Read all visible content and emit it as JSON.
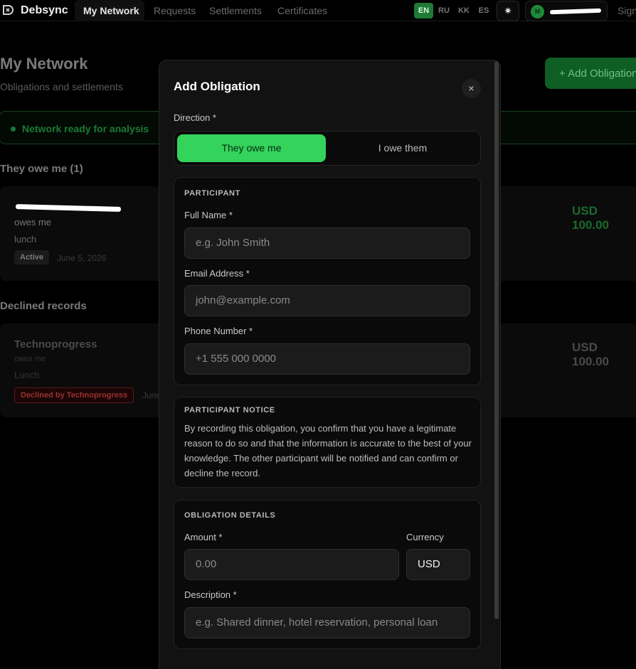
{
  "nav": {
    "brand": "Debsync",
    "links": [
      "My Network",
      "Requests",
      "Settlements",
      "Certificates"
    ],
    "languages": [
      "EN",
      "RU",
      "KK",
      "ES"
    ],
    "active_language": "EN",
    "theme_icon": "sun-icon",
    "avatar_initial": "M",
    "sign_out": "Sign"
  },
  "page": {
    "title": "My Network",
    "subtitle": "Obligations and settlements",
    "add_button": "+ Add Obligation",
    "status": "Network ready for analysis"
  },
  "sections": {
    "owe_me_heading": "They owe me (1)",
    "declined_heading": "Declined records"
  },
  "cards": [
    {
      "relation": "owes me",
      "description": "lunch",
      "badge": "Active",
      "date": "June 5, 2026",
      "amount": "USD 100.00"
    },
    {
      "name": "Technoprogress",
      "relation": "owes me",
      "description": "Lunch",
      "badge": "Declined by Technoprogress",
      "date": "June",
      "amount": "USD 100.00"
    }
  ],
  "modal": {
    "title": "Add Obligation",
    "close_icon": "×",
    "direction_label": "Direction *",
    "direction_options": [
      "They owe me",
      "I owe them"
    ],
    "participant": {
      "heading": "PARTICIPANT",
      "full_name_label": "Full Name *",
      "full_name_placeholder": "e.g. John Smith",
      "email_label": "Email Address *",
      "email_placeholder": "john@example.com",
      "phone_label": "Phone Number *",
      "phone_placeholder": "+1 555 000 0000"
    },
    "notice": {
      "heading": "PARTICIPANT NOTICE",
      "text": "By recording this obligation, you confirm that you have a legitimate reason to do so and that the information is accurate to the best of your knowledge. The other participant will be notified and can confirm or decline the record."
    },
    "details": {
      "heading": "OBLIGATION DETAILS",
      "amount_label": "Amount *",
      "amount_placeholder": "0.00",
      "currency_label": "Currency",
      "currency_value": "USD",
      "description_label": "Description *",
      "description_placeholder": "e.g. Shared dinner, hotel reservation, personal loan"
    }
  },
  "colors": {
    "accent": "#34d35c",
    "background": "#000000",
    "modal": "#121212"
  }
}
